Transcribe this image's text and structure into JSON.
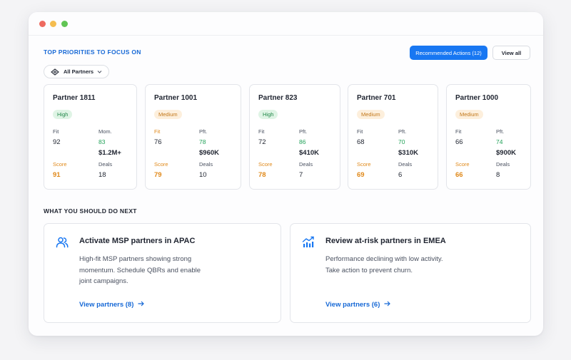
{
  "window": {
    "controls": [
      "close",
      "minimize",
      "maximize"
    ]
  },
  "priorities": {
    "title": "TOP PRIORITIES TO FOCUS ON",
    "recommended_label": "Recommended Actions (12)",
    "view_all_label": "View all",
    "filter_label": "All Partners"
  },
  "partners": [
    {
      "name": "Partner 1811",
      "priority": "High",
      "fit_label": "Fit",
      "fit": "92",
      "metric_label": "Mom.",
      "metric": "83",
      "amount": "$1.2M+",
      "score_label": "Score",
      "score": "91",
      "deals_label": "Deals",
      "deals": "18"
    },
    {
      "name": "Partner 1001",
      "priority": "Medium",
      "fit_label": "Fit",
      "fit": "76",
      "metric_label": "Pft.",
      "metric": "78",
      "amount": "$960K",
      "score_label": "Score",
      "score": "79",
      "deals_label": "Deals",
      "deals": "10"
    },
    {
      "name": "Partner 823",
      "priority": "High",
      "fit_label": "Fit",
      "fit": "72",
      "metric_label": "Pft.",
      "metric": "86",
      "amount": "$410K",
      "score_label": "Score",
      "score": "78",
      "deals_label": "Deals",
      "deals": "7"
    },
    {
      "name": "Partner 701",
      "priority": "Medium",
      "fit_label": "Fit",
      "fit": "68",
      "metric_label": "Pft.",
      "metric": "70",
      "amount": "$310K",
      "score_label": "Score",
      "score": "69",
      "deals_label": "Deals",
      "deals": "6"
    },
    {
      "name": "Partner 1000",
      "priority": "Medium",
      "fit_label": "Fit",
      "fit": "66",
      "metric_label": "Pft.",
      "metric": "74",
      "amount": "$900K",
      "score_label": "Score",
      "score": "66",
      "deals_label": "Deals",
      "deals": "8"
    }
  ],
  "next": {
    "title": "WHAT YOU SHOULD DO NEXT",
    "cards": [
      {
        "icon": "users-icon",
        "title": "Activate MSP partners in APAC",
        "desc": [
          "High-fit MSP partners showing strong",
          "momentum. Schedule QBRs and enable",
          "joint campaigns."
        ],
        "link": "View partners (8)"
      },
      {
        "icon": "trend-up-chart-icon",
        "title": "Review at-risk partners in EMEA",
        "desc": [
          "Performance declining with low activity.",
          "Take action to prevent churn."
        ],
        "link": "View partners (6)"
      }
    ]
  },
  "colors": {
    "accent": "#1877f2",
    "link": "#1769d6",
    "score": "#e0891a",
    "positive": "#23a25a",
    "high_badge_bg": "#dff4e5",
    "medium_badge_bg": "#fdefdc"
  }
}
